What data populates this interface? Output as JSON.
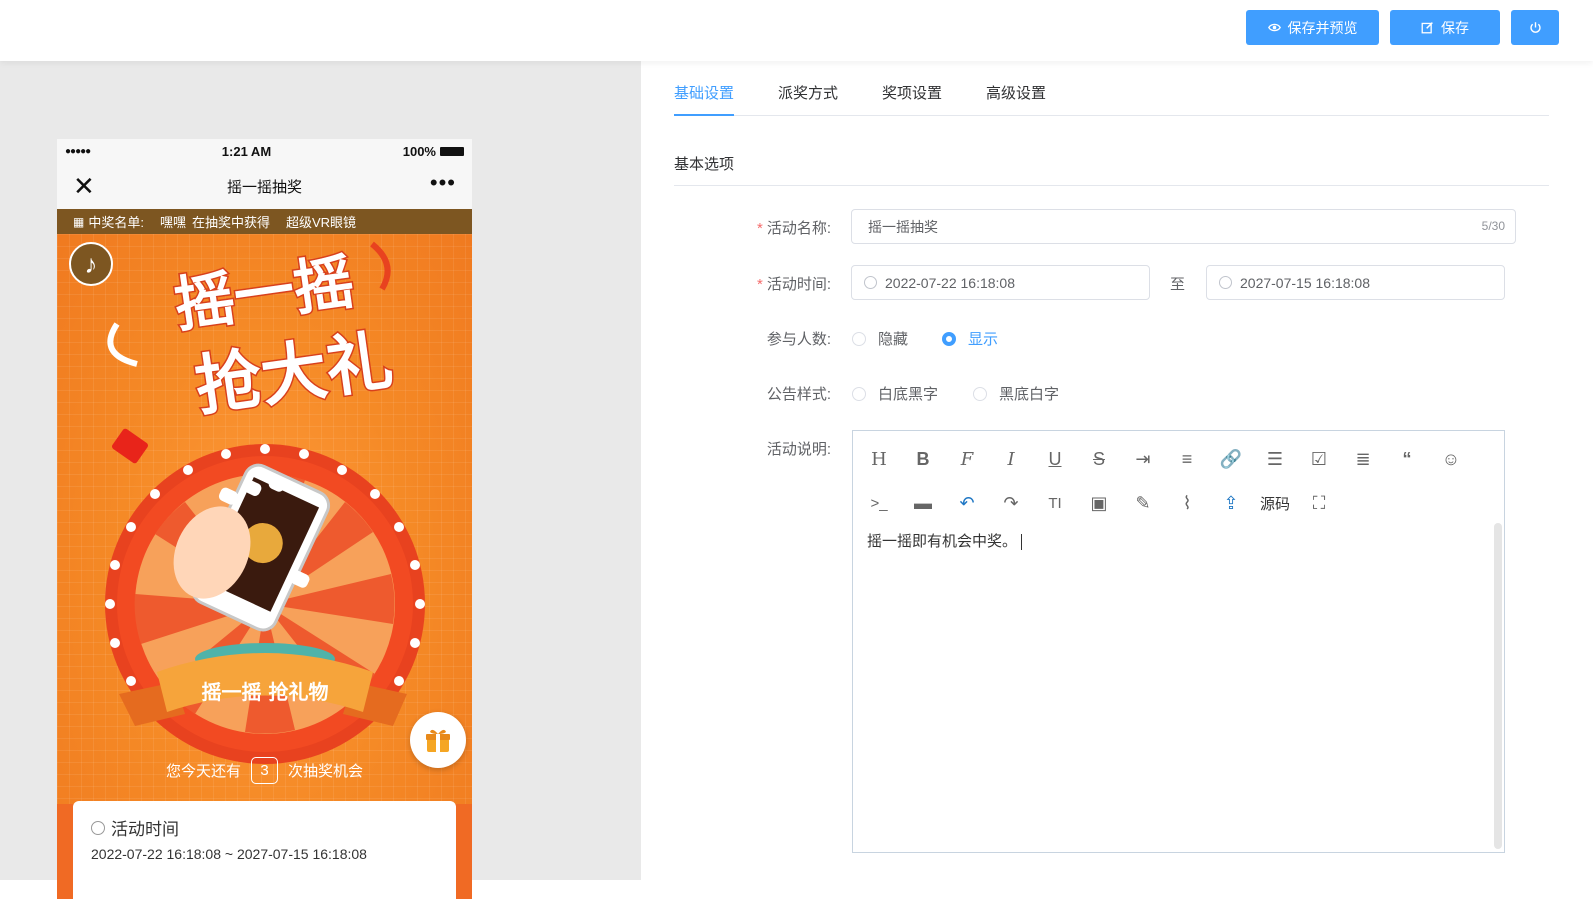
{
  "toolbar": {
    "save_preview": "保存并预览",
    "save": "保存",
    "power_icon": "power-icon"
  },
  "phone": {
    "carrier": "●●●●●",
    "time": "1:21 AM",
    "battery": "100%",
    "title": "摇一摇抽奖",
    "more": "•••",
    "winners_label": "中奖名单:",
    "winner_user": "嘿嘿",
    "winner_text": "在抽奖中获得",
    "winner_prize": "超级VR眼镜",
    "poster_title_1": "摇一摇",
    "poster_title_2": "抢大礼",
    "banner": "摇一摇 抢礼物",
    "chances_prefix": "您今天还有",
    "chances_count": "3",
    "chances_suffix": "次抽奖机会",
    "time_card_title": "活动时间",
    "time_card_value": "2022-07-22 16:18:08 ~ 2027-07-15 16:18:08"
  },
  "tabs": [
    "基础设置",
    "派奖方式",
    "奖项设置",
    "高级设置"
  ],
  "section_title": "基本选项",
  "form": {
    "name_label": "活动名称:",
    "name_value": "摇一摇抽奖",
    "name_count": "5/30",
    "time_label": "活动时间:",
    "start_time": "2022-07-22 16:18:08",
    "to": "至",
    "end_time": "2027-07-15 16:18:08",
    "participants_label": "参与人数:",
    "participants_options": [
      "隐藏",
      "显示"
    ],
    "participants_selected": "显示",
    "notice_label": "公告样式:",
    "notice_options": [
      "白底黑字",
      "黑底白字"
    ],
    "desc_label": "活动说明:",
    "desc_value": "摇一摇即有机会中奖。",
    "source_label": "源码"
  },
  "colors": {
    "primary": "#409eff",
    "danger": "#f56c6c",
    "poster_orange": "#f58a26",
    "winner_bar": "#7d5621"
  }
}
